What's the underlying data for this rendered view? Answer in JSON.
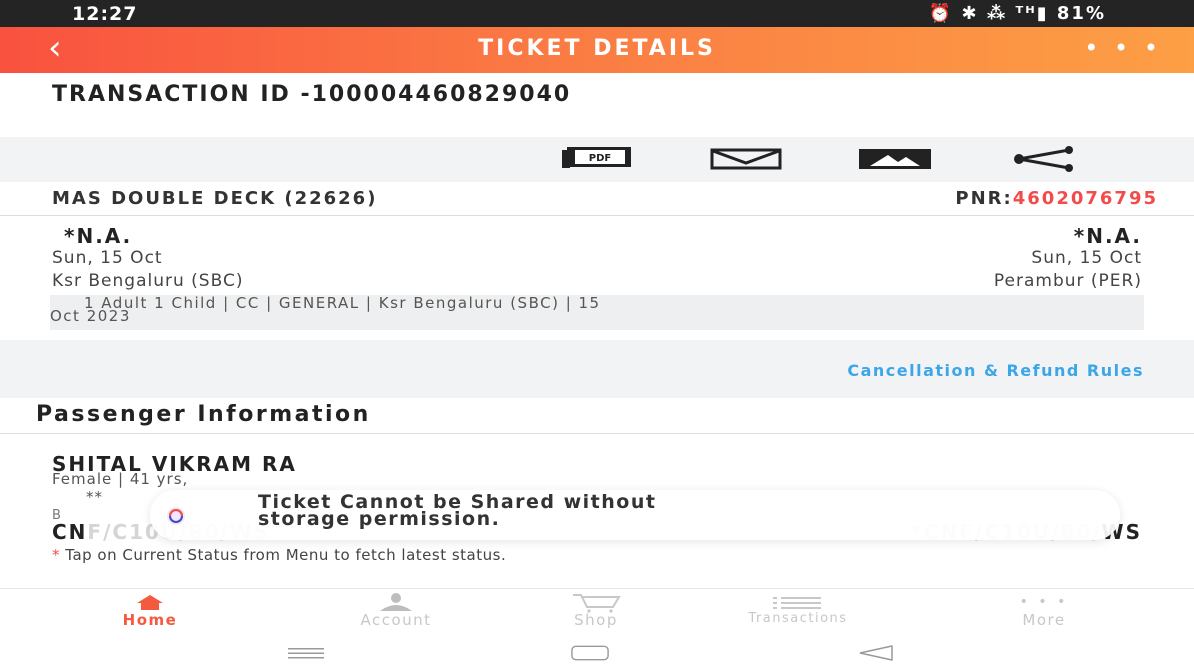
{
  "status_bar": {
    "time": "12:27",
    "indicators": "⏰ ✱ ⁂ ᵀᴴ▮ 81%",
    "battery": "81%"
  },
  "header": {
    "title": "TICKET DETAILS",
    "back_icon": "back-arrow-icon",
    "more_icon": "more-dots-icon",
    "more_label": "• • •"
  },
  "transaction": {
    "label": "TRANSACTION ID -100004460829040"
  },
  "actions": [
    {
      "name": "pdf-icon",
      "text": "PDF"
    },
    {
      "name": "email-icon"
    },
    {
      "name": "image-icon"
    },
    {
      "name": "share-icon"
    }
  ],
  "train": {
    "name": "MAS DOUBLE DECK (22626)",
    "pnr_label": "PNR:",
    "pnr_value": "4602076795"
  },
  "journey": {
    "from_time": "*N.A.",
    "to_time": "*N.A.",
    "from_date": "Sun, 15 Oct",
    "to_date": "Sun, 15 Oct",
    "from_station": "Ksr Bengaluru (SBC)",
    "to_station": "Perambur (PER)",
    "details_line1": "1 Adult 1 Child  | CC | GENERAL | Ksr Bengaluru (SBC) | 15",
    "details_line2": "Oct 2023"
  },
  "refund": {
    "link": "Cancellation & Refund Rules"
  },
  "passenger_section": {
    "title": "Passenger Information"
  },
  "passenger": {
    "name": "SHITAL VIKRAM RA",
    "details": "Female | 41 yrs,",
    "sub": "**",
    "berth_label": "B",
    "status_left_prefix": "CN",
    "status_left_faded": "F/C10U/80/WS",
    "status_right_faded": "*CNF/C10U/80/",
    "status_right_suffix": "WS"
  },
  "toast": {
    "line1": "Ticket Cannot be Shared without",
    "line2": "storage permission."
  },
  "note": {
    "star": "*",
    "text": " Tap on Current Status from Menu to fetch latest status."
  },
  "bottom_nav": [
    {
      "label": "Home",
      "icon": "home-icon",
      "active": true
    },
    {
      "label": "Account",
      "icon": "account-icon",
      "active": false
    },
    {
      "label": "Shop",
      "icon": "cart-icon",
      "active": false
    },
    {
      "label": "Transactions",
      "icon": "list-icon",
      "active": false
    },
    {
      "label": "More",
      "icon": "more-dots-icon",
      "active": false,
      "icon_text": "• • •"
    }
  ],
  "colors": {
    "header_start": "#f9523f",
    "header_end": "#fd9f45",
    "accent": "#f45a3f",
    "pnr": "#f24b4b",
    "link": "#3ba6e8"
  }
}
